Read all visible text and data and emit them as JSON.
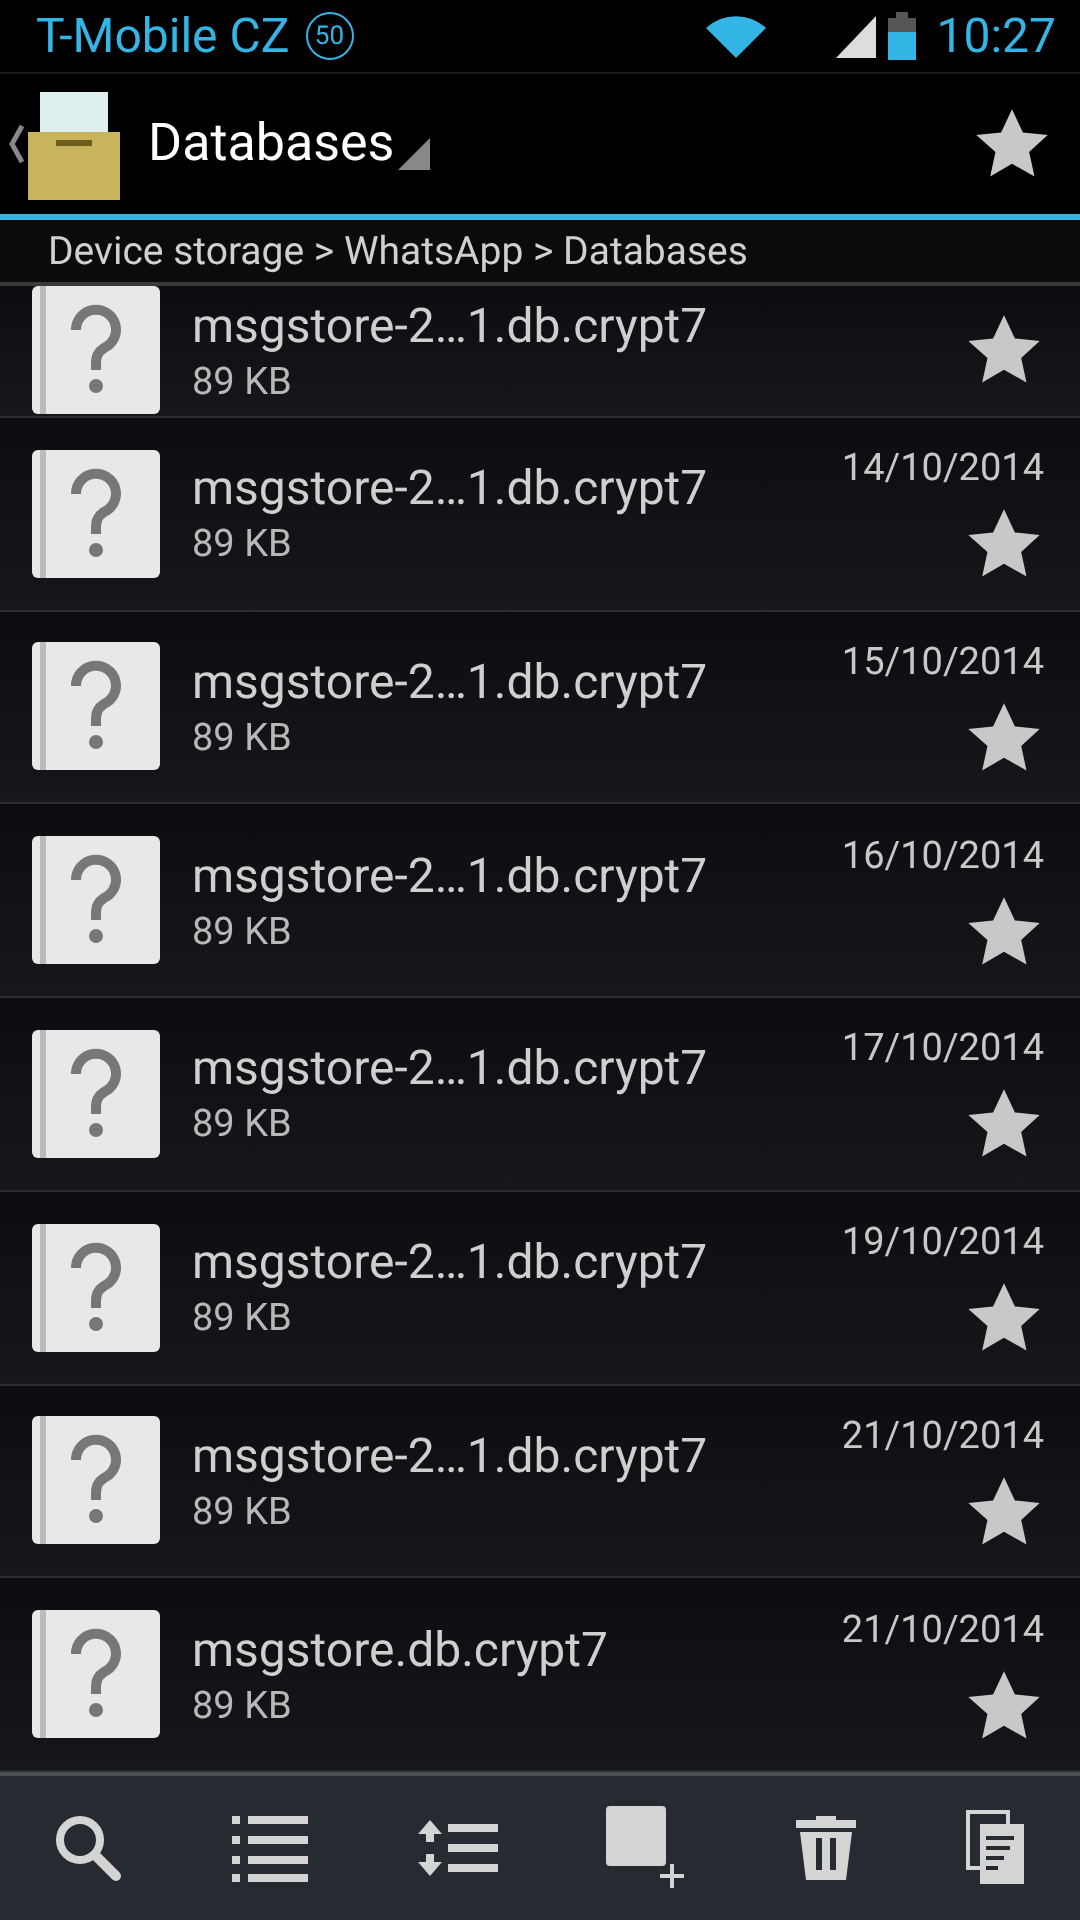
{
  "status_bar": {
    "carrier": "T-Mobile CZ",
    "notification": "50",
    "time": "10:27"
  },
  "action_bar": {
    "title": "Databases"
  },
  "breadcrumb": "Device storage > WhatsApp > Databases",
  "files": [
    {
      "name": "msgstore-2…1.db.crypt7",
      "size": "89 KB"
    },
    {
      "name": "msgstore-2…1.db.crypt7",
      "size": "89 KB",
      "date": "14/10/2014"
    },
    {
      "name": "msgstore-2…1.db.crypt7",
      "size": "89 KB",
      "date": "15/10/2014"
    },
    {
      "name": "msgstore-2…1.db.crypt7",
      "size": "89 KB",
      "date": "16/10/2014"
    },
    {
      "name": "msgstore-2…1.db.crypt7",
      "size": "89 KB",
      "date": "17/10/2014"
    },
    {
      "name": "msgstore-2…1.db.crypt7",
      "size": "89 KB",
      "date": "19/10/2014"
    },
    {
      "name": "msgstore-2…1.db.crypt7",
      "size": "89 KB",
      "date": "21/10/2014"
    },
    {
      "name": "msgstore.db.crypt7",
      "size": "89 KB",
      "date": "21/10/2014"
    }
  ]
}
